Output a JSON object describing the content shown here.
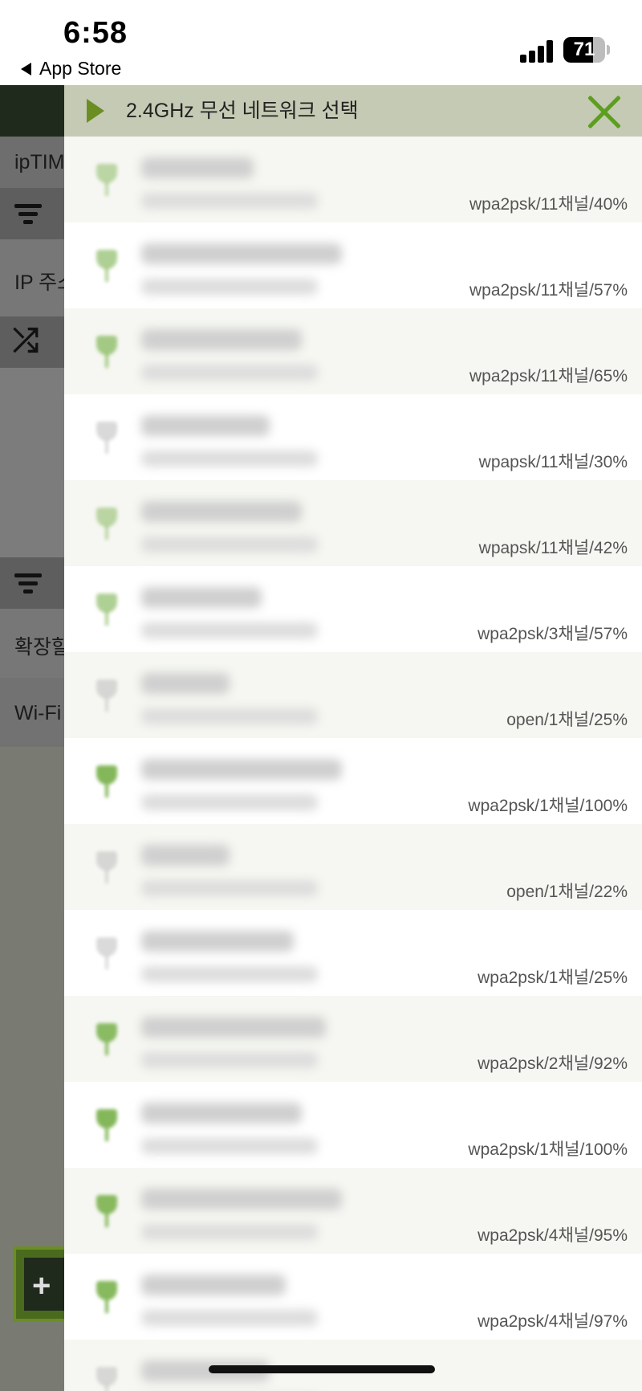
{
  "status_bar": {
    "time": "6:58",
    "back_label": "App Store",
    "battery_level": "71"
  },
  "background_app": {
    "header_partial": "ipTIM",
    "ip_label": "IP 주소",
    "extend_label": "확장할",
    "wifi_label": "Wi-Fi"
  },
  "dialog": {
    "title": "2.4GHz 무선 네트워크 선택",
    "accent_color": "#6b8e23",
    "networks": [
      {
        "info": "wpa2psk/11채널/40%",
        "signal": 0.4
      },
      {
        "info": "wpa2psk/11채널/57%",
        "signal": 0.57
      },
      {
        "info": "wpa2psk/11채널/65%",
        "signal": 0.65
      },
      {
        "info": "wpapsk/11채널/30%",
        "signal": 0.3
      },
      {
        "info": "wpapsk/11채널/42%",
        "signal": 0.42
      },
      {
        "info": "wpa2psk/3채널/57%",
        "signal": 0.57
      },
      {
        "info": "open/1채널/25%",
        "signal": 0.25
      },
      {
        "info": "wpa2psk/1채널/100%",
        "signal": 1.0
      },
      {
        "info": "open/1채널/22%",
        "signal": 0.22
      },
      {
        "info": "wpa2psk/1채널/25%",
        "signal": 0.25
      },
      {
        "info": "wpa2psk/2채널/92%",
        "signal": 0.92
      },
      {
        "info": "wpa2psk/1채널/100%",
        "signal": 1.0
      },
      {
        "info": "wpa2psk/4채널/95%",
        "signal": 0.95
      },
      {
        "info": "wpa2psk/4채널/97%",
        "signal": 0.97
      },
      {
        "info": "",
        "signal": 0.2
      }
    ]
  }
}
